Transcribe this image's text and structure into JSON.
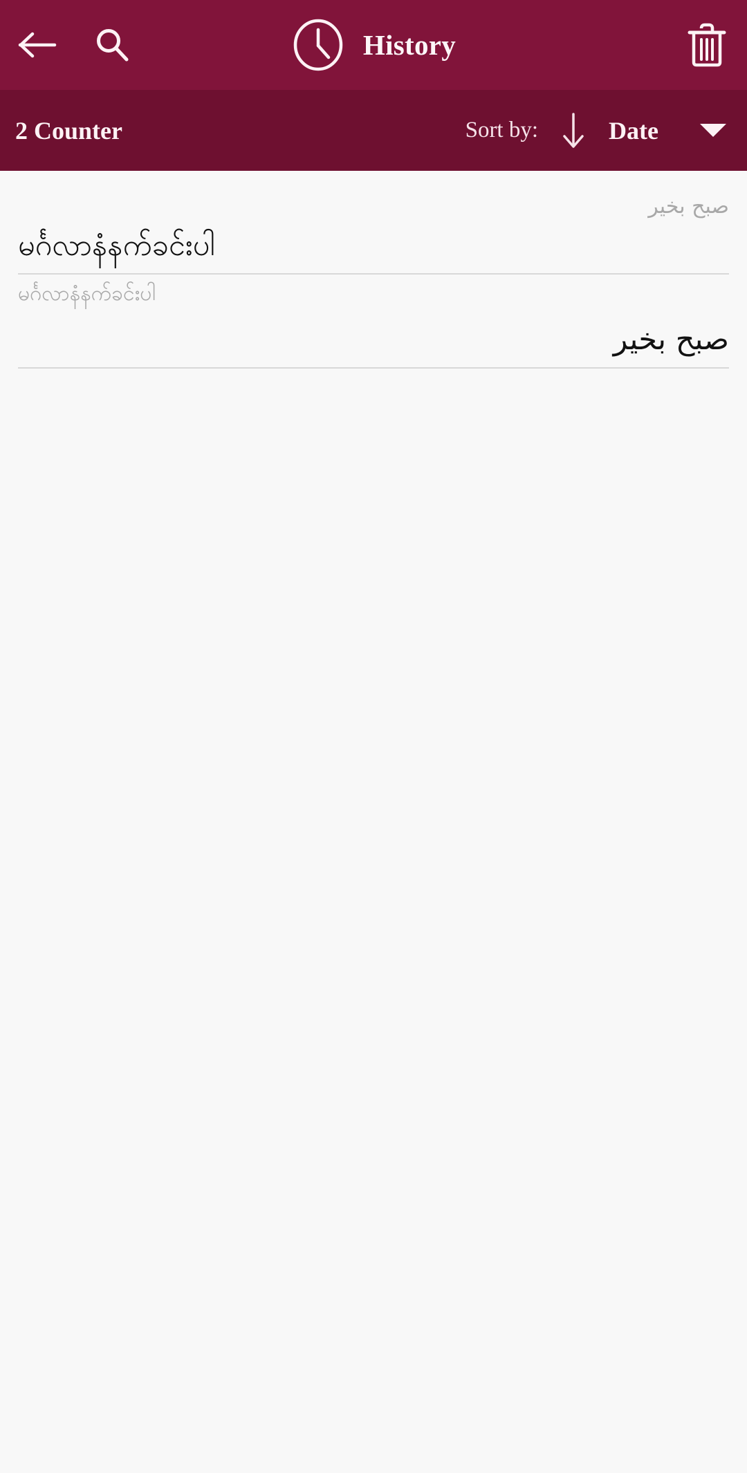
{
  "theme": {
    "appbar_color": "#81143a",
    "subbar_color": "#6e1030",
    "background_color": "#f8f8f8",
    "divider_color": "#d8d8d8",
    "primary_text_color": "#121212",
    "secondary_text_color": "#a8a8a8",
    "on_primary_text_color": "#fdf2f5"
  },
  "appbar": {
    "back_icon": "back-arrow-icon",
    "search_icon": "search-icon",
    "clock_icon": "clock-icon",
    "title": "History",
    "delete_icon": "trash-icon"
  },
  "subbar": {
    "counter_label": "2 Counter",
    "sort_by_label": "Sort by:",
    "sort_direction_icon": "arrow-down-icon",
    "sort_value": "Date",
    "dropdown_icon": "caret-down-icon"
  },
  "history": {
    "items": [
      {
        "secondary": "صبح بخير",
        "secondary_dir": "rtl",
        "secondary_script": "ar",
        "primary": "မင်္ဂလာနံနက်ခင်းပါ",
        "primary_dir": "ltr",
        "primary_script": "mm"
      },
      {
        "secondary": "မင်္ဂလာနံနက်ခင်းပါ",
        "secondary_dir": "ltr",
        "secondary_script": "mm",
        "primary": "صبح بخير",
        "primary_dir": "rtl",
        "primary_script": "ar"
      }
    ]
  }
}
